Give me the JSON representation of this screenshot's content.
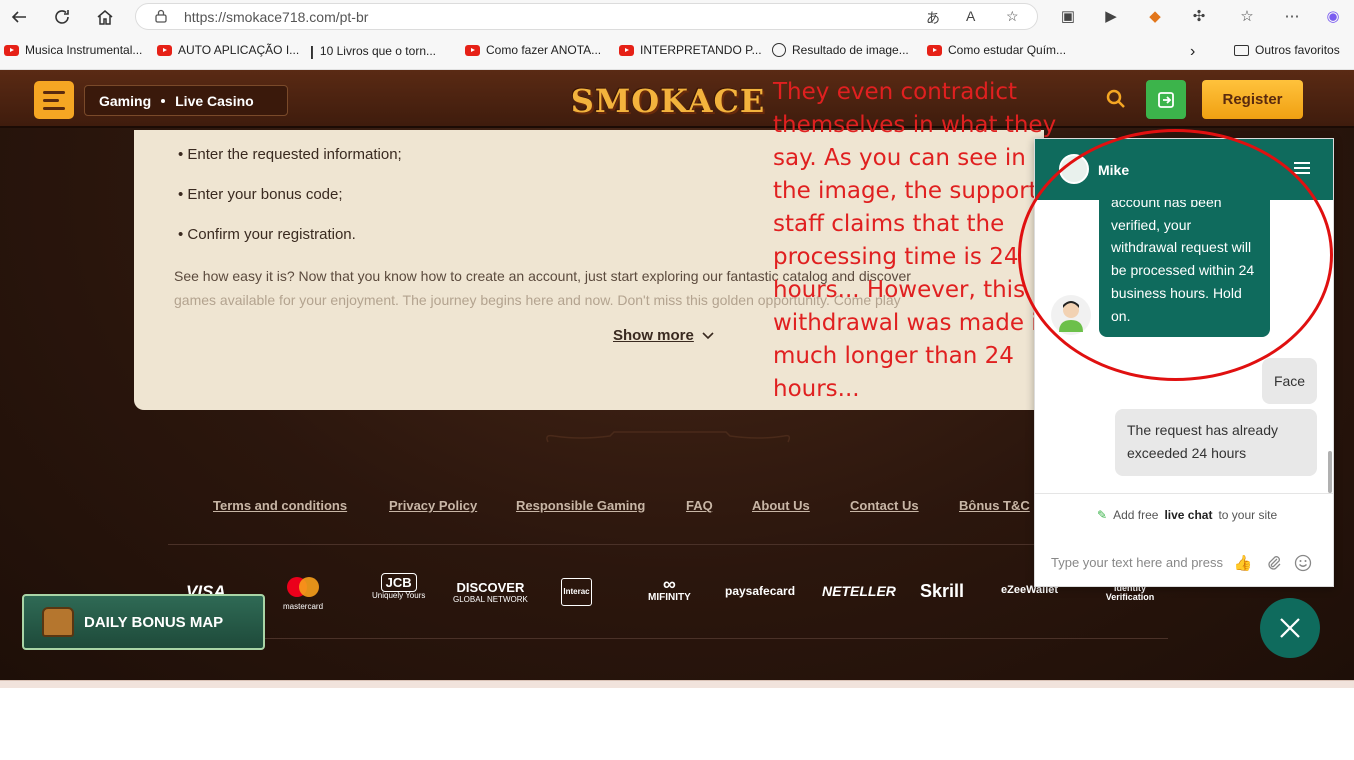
{
  "browser": {
    "url": "https://smokace718.com/pt-br",
    "bookmarks": [
      {
        "label": "Musica Instrumental...",
        "icon": "youtube-icon"
      },
      {
        "label": "AUTO APLICAÇÃO I...",
        "icon": "youtube-icon"
      },
      {
        "label": "10 Livros que o torn...",
        "icon": "bookmark-icon"
      },
      {
        "label": "Como fazer ANOTA...",
        "icon": "youtube-icon"
      },
      {
        "label": "INTERPRETANDO P...",
        "icon": "youtube-icon"
      },
      {
        "label": "Resultado de image...",
        "icon": "globe-icon"
      },
      {
        "label": "Como estudar Quím...",
        "icon": "youtube-icon"
      }
    ],
    "other_favorites": "Outros favoritos"
  },
  "site": {
    "nav_gaming": "Gaming",
    "nav_live_casino": "Live Casino",
    "logo_text": "SMOKACE",
    "register": "Register"
  },
  "content": {
    "bullets": [
      "• Enter the requested information;",
      "• Enter your bonus code;",
      "• Confirm your registration."
    ],
    "paragraph_line1": "See how easy it is? Now that you know how to create an account, just start exploring our fantastic catalog and discover",
    "paragraph_line2": "games available for your enjoyment. The journey begins here and now. Don't miss this golden opportunity. Come play",
    "show_more": "Show more"
  },
  "footer": {
    "links": [
      "Terms and conditions",
      "Privacy Policy",
      "Responsible Gaming",
      "FAQ",
      "About Us",
      "Contact Us",
      "Bônus T&C"
    ],
    "payments": [
      "VISA",
      "mastercard",
      "JCB",
      "DISCOVER",
      "Interac",
      "MIFINITY",
      "paysafecard",
      "NETELLER",
      "Skrill",
      "eZeeWallet",
      "Identity Verification"
    ],
    "jcb_sub": "Uniquely Yours",
    "discover_sub": "GLOBAL NETWORK"
  },
  "bonus_map": "DAILY BONUS MAP",
  "annotation": "They even contradict themselves in what they say. As you can see in the image, the support staff claims that the processing time is 24 hours... However, this withdrawal was made in much longer than 24 hours...",
  "chat": {
    "agent_name": "Mike",
    "agent_message": "account has been verified, your withdrawal request will be processed within 24 business hours. Hold on.",
    "user_message_1": "Face",
    "user_message_2": "The request has already exceeded 24 hours",
    "powered_pre": "Add free",
    "powered_bold": "live chat",
    "powered_post": "to your site",
    "input_placeholder": "Type your text here and press"
  }
}
